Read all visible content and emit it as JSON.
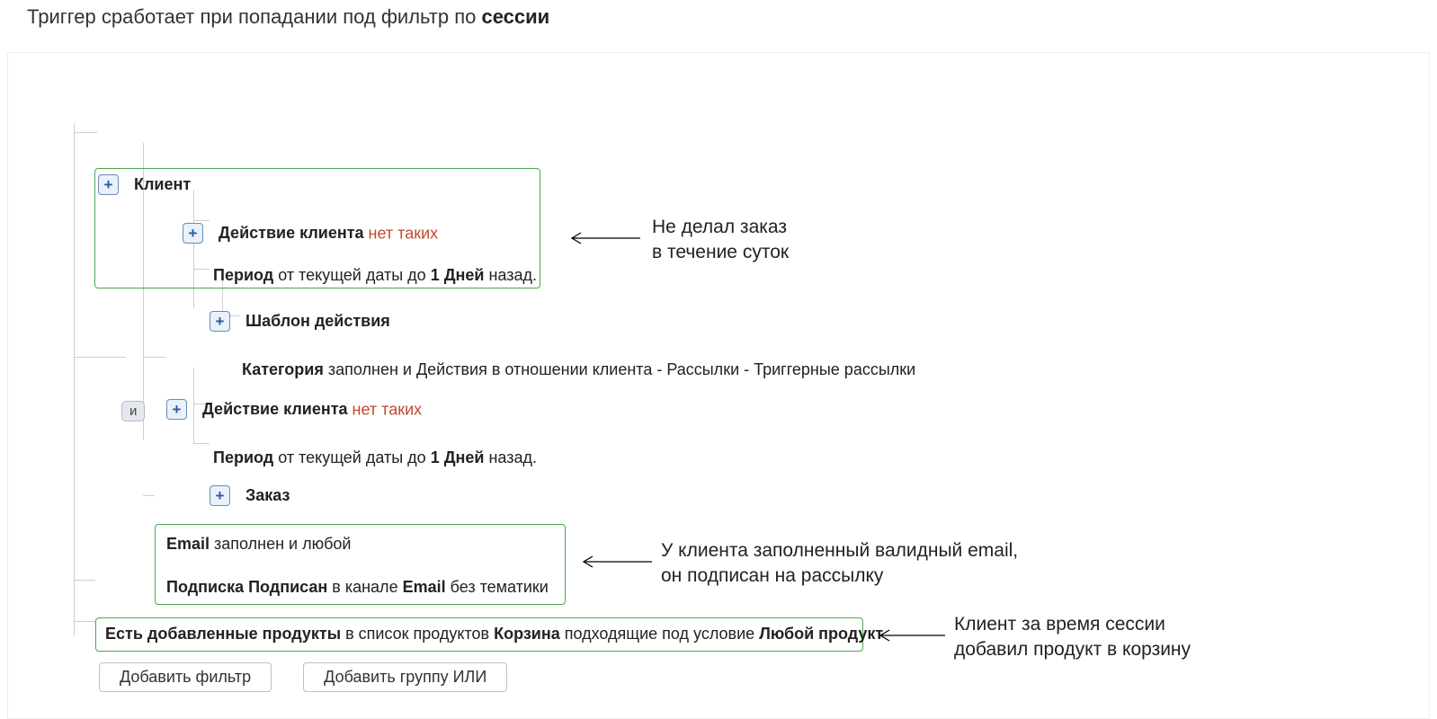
{
  "heading": {
    "text": "Триггер сработает при попадании под фильтр по ",
    "bold": "сессии"
  },
  "node_client": "Клиент",
  "action1": {
    "label": "Действие клиента ",
    "tag": "нет таких"
  },
  "period1": {
    "pref": "Период ",
    "mid": "от текущей даты до ",
    "num": "1 Дней ",
    "suf": "назад."
  },
  "template": "Шаблон действия",
  "category": {
    "label": "Категория ",
    "text": "заполнен и Действия в отношении клиента - Рассылки - Триггерные рассылки"
  },
  "and_pill": "и",
  "action2": {
    "label": "Действие клиента ",
    "tag": "нет таких"
  },
  "period2": {
    "pref": "Период ",
    "mid": "от текущей даты до ",
    "num": "1 Дней ",
    "suf": "назад."
  },
  "order": "Заказ",
  "email_line": {
    "b1": "Email ",
    "t1": "заполнен и любой"
  },
  "sub_line": {
    "b1": "Подписка Подписан ",
    "t1": " в канале ",
    "b2": "Email ",
    "t2": "без тематики"
  },
  "products_line": {
    "b1": "Есть добавленные продукты ",
    "t1": "в список продуктов ",
    "b2": "Корзина ",
    "t2": "подходящие под условие ",
    "b3": "Любой продукт"
  },
  "btn_add_filter": "Добавить фильтр",
  "btn_add_or": "Добавить группу ИЛИ",
  "annot1": {
    "l1": "Не делал заказ",
    "l2": "в течение суток"
  },
  "annot2": {
    "l1": "У клиента заполненный валидный email,",
    "l2": "он подписан на рассылку"
  },
  "annot3": {
    "l1": "Клиент за время сессии",
    "l2": "добавил продукт в корзину"
  }
}
